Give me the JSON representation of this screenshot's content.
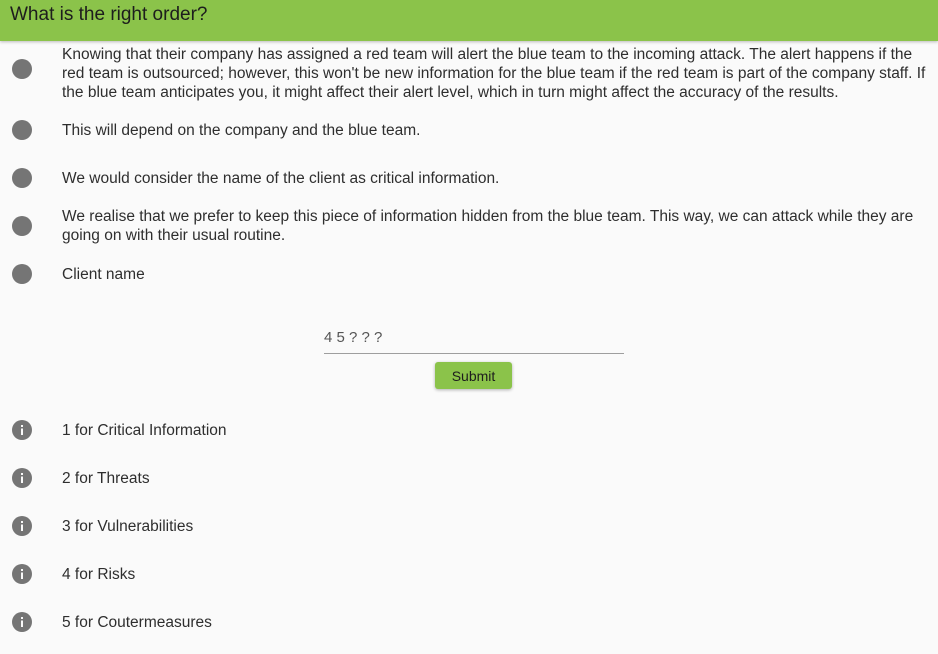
{
  "header": {
    "title": "What is the right order?",
    "color": "#8bc34a"
  },
  "options": [
    {
      "text": "Knowing that their company has assigned a red team will alert the blue team to the incoming attack. The alert happens if the red team is outsourced; however, this won't be new information for the blue team if the red team is part of the company staff. If the blue team anticipates you, it might affect their alert level, which in turn might affect the accuracy of the results."
    },
    {
      "text": "This will depend on the company and the blue team."
    },
    {
      "text": "We would consider the name of the client as critical information."
    },
    {
      "text": "We realise that we prefer to keep this piece of information hidden from the blue team. This way, we can attack while they are going on with their usual routine."
    },
    {
      "text": "Client name"
    }
  ],
  "answer": {
    "value": "4 5 ? ? ?"
  },
  "submit": {
    "label": "Submit"
  },
  "legend": [
    {
      "icon": "info-icon",
      "text": "1 for Critical Information"
    },
    {
      "icon": "info-icon",
      "text": "2 for Threats"
    },
    {
      "icon": "info-icon",
      "text": "3 for Vulnerabilities"
    },
    {
      "icon": "info-icon",
      "text": "4 for Risks"
    },
    {
      "icon": "info-icon",
      "text": "5 for Coutermeasures"
    }
  ]
}
